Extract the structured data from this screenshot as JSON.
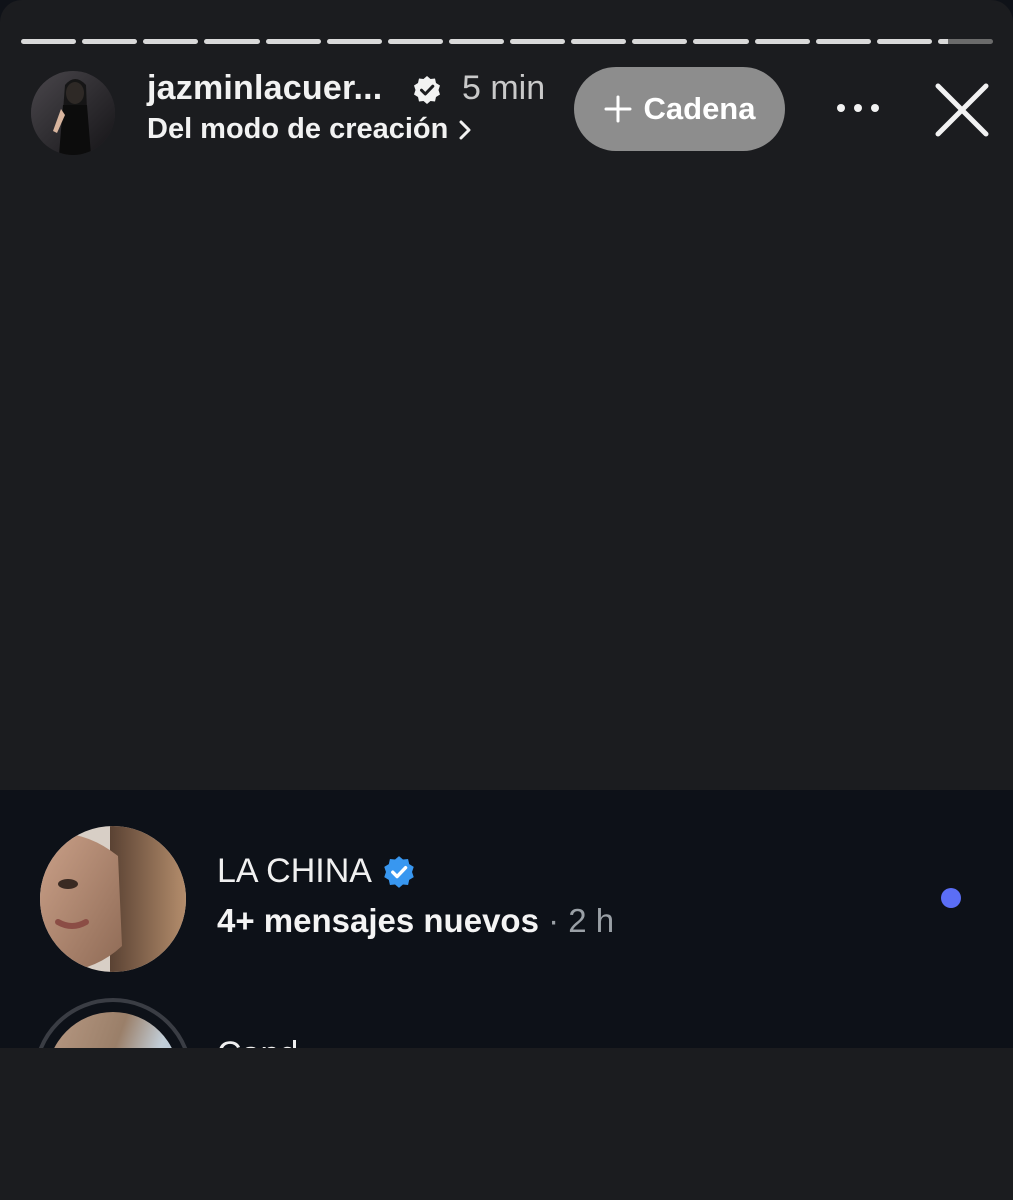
{
  "story": {
    "progress_total_segments": 16,
    "progress_completed_segments": 15,
    "progress_current_fraction": 0.18,
    "username": "jazminlacuer...",
    "time": "5 min",
    "subtitle": "Del modo de creación",
    "chain_button_label": "Cadena",
    "more_icon": "ellipsis-icon",
    "close_icon": "close-icon"
  },
  "inbox": {
    "rows": [
      {
        "name": "LA CHINA",
        "verified": true,
        "message": "4+ mensajes nuevos",
        "time": "· 2 h",
        "unread": true
      },
      {
        "name": "Cand",
        "verified": false
      }
    ]
  },
  "colors": {
    "story_bg": "#1b1c1f",
    "inbox_bg": "#0d1118",
    "chain_button": "#8d8d8d",
    "unread_dot": "#5b6ef5",
    "verified_badge": "#3897f0"
  }
}
